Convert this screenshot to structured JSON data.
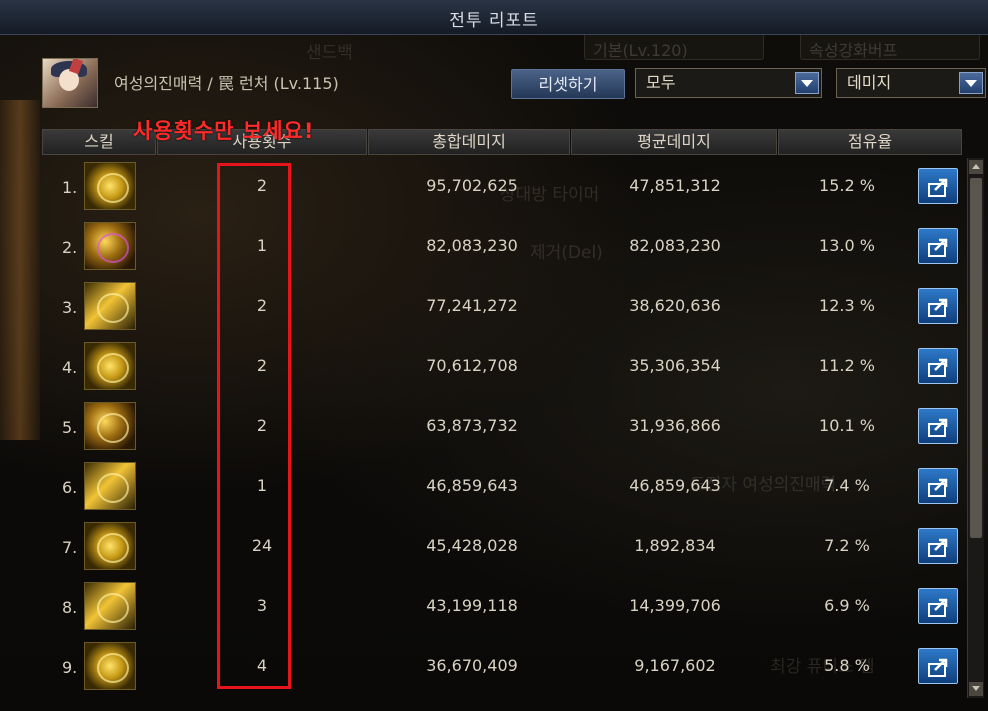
{
  "window": {
    "title": "전투 리포트"
  },
  "background_ghost": {
    "texts": [
      "샌드백",
      "기본(Lv.120)",
      "속성강화버프",
      "상대방 타이머",
      "제거(Del)",
      "도전자 여성의진매력",
      "최강 퓨디소 템"
    ]
  },
  "character": {
    "name": "여성의진매력 / 罠 런처 (Lv.115)"
  },
  "controls": {
    "reset_label": "리셋하기",
    "filter_value": "모두",
    "metric_value": "데미지"
  },
  "annotation": {
    "note": "사용횟수만 보세요!"
  },
  "columns": [
    "스킬",
    "사용횟수",
    "총합데미지",
    "평균데미지",
    "점유율"
  ],
  "rows": [
    {
      "rank": "1.",
      "count": "2",
      "total": "95,702,625",
      "avg": "47,851,312",
      "share": "15.2 %"
    },
    {
      "rank": "2.",
      "count": "1",
      "total": "82,083,230",
      "avg": "82,083,230",
      "share": "13.0 %"
    },
    {
      "rank": "3.",
      "count": "2",
      "total": "77,241,272",
      "avg": "38,620,636",
      "share": "12.3 %"
    },
    {
      "rank": "4.",
      "count": "2",
      "total": "70,612,708",
      "avg": "35,306,354",
      "share": "11.2 %"
    },
    {
      "rank": "5.",
      "count": "2",
      "total": "63,873,732",
      "avg": "31,936,866",
      "share": "10.1 %"
    },
    {
      "rank": "6.",
      "count": "1",
      "total": "46,859,643",
      "avg": "46,859,643",
      "share": "7.4 %"
    },
    {
      "rank": "7.",
      "count": "24",
      "total": "45,428,028",
      "avg": "1,892,834",
      "share": "7.2 %"
    },
    {
      "rank": "8.",
      "count": "3",
      "total": "43,199,118",
      "avg": "14,399,706",
      "share": "6.9 %"
    },
    {
      "rank": "9.",
      "count": "4",
      "total": "36,670,409",
      "avg": "9,167,602",
      "share": "5.8 %"
    }
  ],
  "colors": {
    "accent_red": "#e8141b",
    "share_button": "#1f5fae"
  },
  "icons": [
    "skill-icon",
    "share-icon",
    "dropdown-arrow-icon",
    "scroll-up-icon",
    "scroll-down-icon"
  ]
}
